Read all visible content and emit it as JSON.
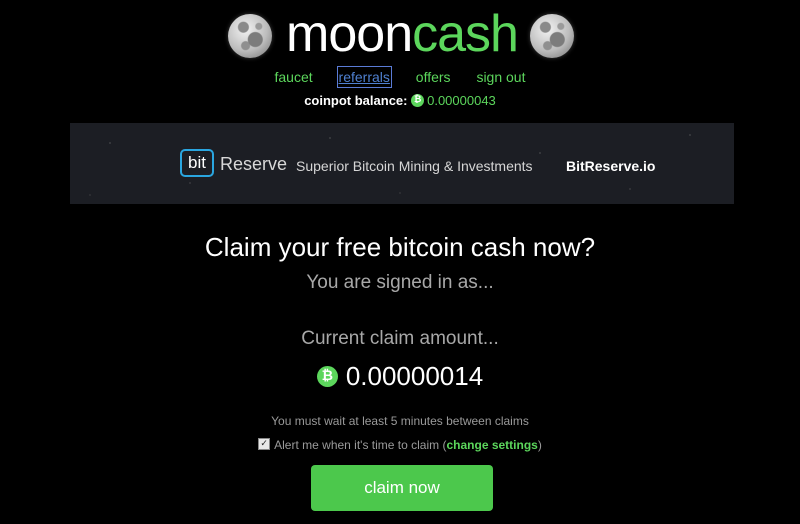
{
  "header": {
    "logo_moon": "moon",
    "logo_cash": "cash",
    "moon_icon": "moon-icon",
    "accent_color": "#5cd65c"
  },
  "nav": {
    "faucet": "faucet",
    "referrals": "referrals",
    "offers": "offers",
    "sign_out": "sign out"
  },
  "balance": {
    "label": "coinpot balance:",
    "value": "0.00000043",
    "icon": "bitcoin-cash-icon"
  },
  "banner": {
    "bit": "bit",
    "reserve": "Reserve",
    "tagline": "Superior Bitcoin Mining & Investments",
    "site": "BitReserve.io"
  },
  "main": {
    "headline": "Claim your free bitcoin cash now?",
    "signed_in": "You are signed in as...",
    "claim_label": "Current claim amount...",
    "claim_amount": "0.00000014",
    "wait_notice": "You must wait at least 5 minutes between claims",
    "alert_prefix": "Alert me when it's time to claim (",
    "alert_link": "change settings",
    "alert_suffix": ")",
    "alert_checked": true,
    "claim_button": "claim now"
  }
}
